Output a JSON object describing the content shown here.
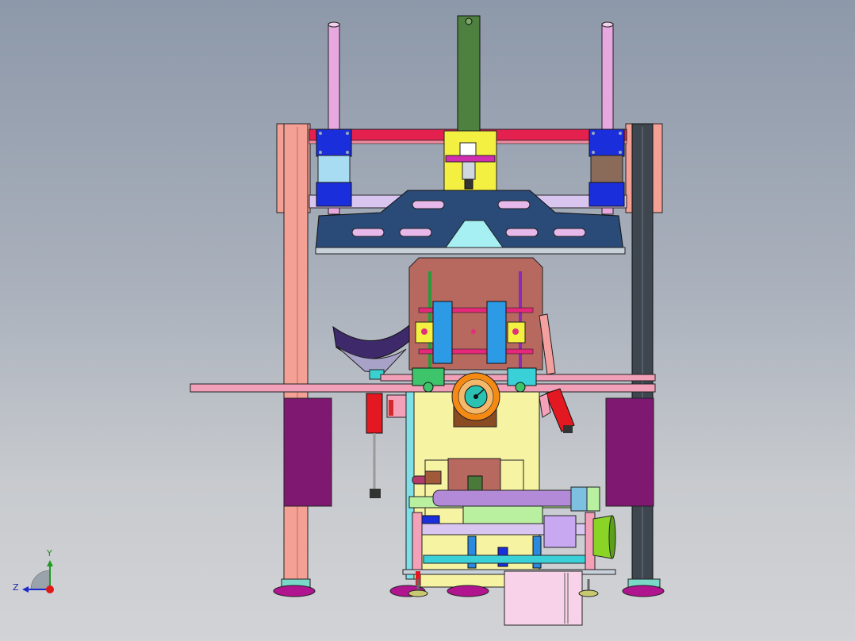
{
  "view": {
    "background_top": "#8d98a9",
    "background_bottom": "#d2d3d6"
  },
  "triad": {
    "y_label": "Y",
    "z_label": "Z",
    "y_color": "#1f9a1f",
    "z_color": "#1a2acc",
    "x_color": "#e01818"
  },
  "colors": {
    "frame_pink": "#f4a095",
    "frame_dark": "#3e4650",
    "rod_pink": "#e7a8e0",
    "bar_red": "#e4204e",
    "bracket_blue": "#2a4a78",
    "bearing_blue": "#1a2edb",
    "cylinder_green": "#4e8040",
    "housing_brown": "#b8695f",
    "body_yellow": "#f6f3a2",
    "motor_purple": "#7f1870",
    "foot_magenta": "#b0148e",
    "hub_orange": "#f48a14",
    "hub_teal": "#2cc2b2"
  }
}
